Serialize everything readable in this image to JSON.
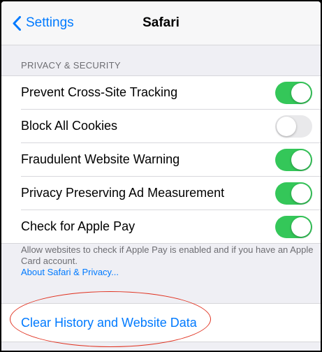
{
  "nav": {
    "back_label": "Settings",
    "title": "Safari"
  },
  "section": {
    "header": "PRIVACY & SECURITY"
  },
  "settings": [
    {
      "label": "Prevent Cross-Site Tracking",
      "on": true
    },
    {
      "label": "Block All Cookies",
      "on": false
    },
    {
      "label": "Fraudulent Website Warning",
      "on": true
    },
    {
      "label": "Privacy Preserving Ad Measurement",
      "on": true
    },
    {
      "label": "Check for Apple Pay",
      "on": true
    }
  ],
  "footer": {
    "text": "Allow websites to check if Apple Pay is enabled and if you have an Apple Card account.",
    "link": "About Safari & Privacy..."
  },
  "action": {
    "label": "Clear History and Website Data"
  },
  "colors": {
    "accent": "#007aff",
    "switch_on": "#34c759",
    "switch_off": "#e9e9eb",
    "annotation": "#e0311f"
  }
}
